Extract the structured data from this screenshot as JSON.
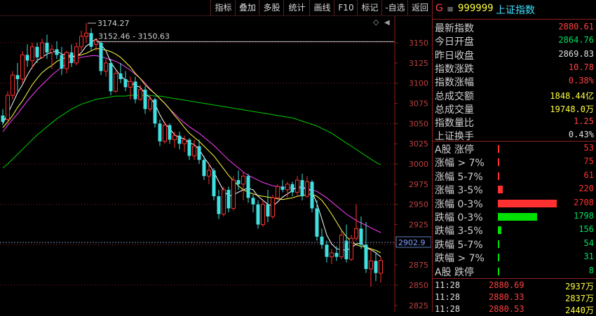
{
  "toolbar": {
    "buttons": [
      "指标",
      "叠加",
      "多股",
      "统计",
      "画线",
      "F10",
      "标记",
      "-自选",
      "返回"
    ]
  },
  "header": {
    "icon_letter": "G",
    "menu_glyph": "≡",
    "code": "999999",
    "name": "上证指数"
  },
  "quote": [
    {
      "label": "最新指数",
      "value": "2880.61",
      "color": "#ff4040"
    },
    {
      "label": "今日开盘",
      "value": "2864.76",
      "color": "#00e060"
    },
    {
      "label": "昨日收盘",
      "value": "2869.83",
      "color": "#e0e0e0"
    },
    {
      "label": "指数涨跌",
      "value": "10.78",
      "color": "#ff4040"
    },
    {
      "label": "指数涨幅",
      "value": "0.38%",
      "color": "#ff4040"
    },
    {
      "label": "总成交额",
      "value": "1848.44亿",
      "color": "#ffff40"
    },
    {
      "label": "总成交量",
      "value": "19748.0万",
      "color": "#ffff40"
    },
    {
      "label": "指数量比",
      "value": "1.25",
      "color": "#ff4040"
    },
    {
      "label": "上证换手",
      "value": "0.43%",
      "color": "#e0e0e0"
    }
  ],
  "breadth": [
    {
      "label": "A股 涨停",
      "value": "53",
      "count": 53,
      "color": "#ff3030",
      "bar": "#ff3030"
    },
    {
      "label": "涨幅 > 7%",
      "value": "75",
      "count": 75,
      "color": "#ff3030",
      "bar": "#ff3030"
    },
    {
      "label": "涨幅 5-7%",
      "value": "61",
      "count": 61,
      "color": "#ff3030",
      "bar": "#ff3030"
    },
    {
      "label": "涨幅 3-5%",
      "value": "220",
      "count": 220,
      "color": "#ff3030",
      "bar": "#ff3030"
    },
    {
      "label": "涨幅 0-3%",
      "value": "2708",
      "count": 2708,
      "color": "#ff3030",
      "bar": "#ff3030"
    },
    {
      "label": "跌幅 0-3%",
      "value": "1798",
      "count": 1798,
      "color": "#00e060",
      "bar": "#00e000"
    },
    {
      "label": "跌幅 3-5%",
      "value": "156",
      "count": 156,
      "color": "#00e060",
      "bar": "#00e000"
    },
    {
      "label": "跌幅 5-7%",
      "value": "54",
      "count": 54,
      "color": "#00e060",
      "bar": "#00e000"
    },
    {
      "label": "跌幅 > 7%",
      "value": "31",
      "count": 31,
      "color": "#00e060",
      "bar": "#00e000"
    },
    {
      "label": "A股 跌停",
      "value": "8",
      "count": 8,
      "color": "#00e060",
      "bar": "#00e000"
    }
  ],
  "ticks": [
    {
      "time": "11:28",
      "price": "2880.69",
      "volume": "2937万"
    },
    {
      "time": "11:28",
      "price": "2880.33",
      "volume": "2837万"
    },
    {
      "time": "11:28",
      "price": "2880.53",
      "volume": "2440万"
    }
  ],
  "chart_data": {
    "type": "candlestick",
    "y_ticks": [
      3150,
      3125,
      3100,
      3075,
      3050,
      3025,
      3000,
      2975,
      2950,
      2925,
      2900,
      2875,
      2850,
      2825
    ],
    "y_range": [
      2817,
      3183
    ],
    "current_price_label": "2902.9",
    "current_price": 2902.9,
    "high_annotation": "3174.27",
    "high_value": 3174.27,
    "high_index": 17,
    "range_annotation": "3152.46 - 3150.63",
    "range_value": 3151.5,
    "range_index": 19,
    "candles": [
      {
        "o": 3060,
        "h": 3068,
        "l": 3048,
        "c": 3052
      },
      {
        "o": 3055,
        "h": 3090,
        "l": 3050,
        "c": 3085
      },
      {
        "o": 3085,
        "h": 3115,
        "l": 3080,
        "c": 3110
      },
      {
        "o": 3110,
        "h": 3125,
        "l": 3090,
        "c": 3105
      },
      {
        "o": 3105,
        "h": 3140,
        "l": 3100,
        "c": 3135
      },
      {
        "o": 3135,
        "h": 3148,
        "l": 3120,
        "c": 3128
      },
      {
        "o": 3128,
        "h": 3150,
        "l": 3118,
        "c": 3145
      },
      {
        "o": 3145,
        "h": 3150,
        "l": 3125,
        "c": 3132
      },
      {
        "o": 3132,
        "h": 3155,
        "l": 3130,
        "c": 3150
      },
      {
        "o": 3150,
        "h": 3160,
        "l": 3130,
        "c": 3138
      },
      {
        "o": 3138,
        "h": 3148,
        "l": 3118,
        "c": 3142
      },
      {
        "o": 3142,
        "h": 3152,
        "l": 3130,
        "c": 3135
      },
      {
        "o": 3135,
        "h": 3145,
        "l": 3110,
        "c": 3118
      },
      {
        "o": 3118,
        "h": 3140,
        "l": 3112,
        "c": 3138
      },
      {
        "o": 3138,
        "h": 3148,
        "l": 3120,
        "c": 3125
      },
      {
        "o": 3125,
        "h": 3150,
        "l": 3122,
        "c": 3145
      },
      {
        "o": 3145,
        "h": 3165,
        "l": 3140,
        "c": 3158
      },
      {
        "o": 3158,
        "h": 3174.27,
        "l": 3150,
        "c": 3162
      },
      {
        "o": 3162,
        "h": 3168,
        "l": 3140,
        "c": 3145
      },
      {
        "o": 3148,
        "h": 3156,
        "l": 3140,
        "c": 3153
      },
      {
        "o": 3150,
        "h": 3152,
        "l": 3110,
        "c": 3115
      },
      {
        "o": 3115,
        "h": 3130,
        "l": 3108,
        "c": 3125
      },
      {
        "o": 3125,
        "h": 3130,
        "l": 3085,
        "c": 3090
      },
      {
        "o": 3090,
        "h": 3115,
        "l": 3088,
        "c": 3112
      },
      {
        "o": 3112,
        "h": 3125,
        "l": 3100,
        "c": 3105
      },
      {
        "o": 3105,
        "h": 3115,
        "l": 3090,
        "c": 3095
      },
      {
        "o": 3095,
        "h": 3108,
        "l": 3080,
        "c": 3102
      },
      {
        "o": 3102,
        "h": 3108,
        "l": 3075,
        "c": 3080
      },
      {
        "o": 3080,
        "h": 3098,
        "l": 3078,
        "c": 3092
      },
      {
        "o": 3092,
        "h": 3096,
        "l": 3062,
        "c": 3068
      },
      {
        "o": 3068,
        "h": 3085,
        "l": 3065,
        "c": 3080
      },
      {
        "o": 3080,
        "h": 3082,
        "l": 3045,
        "c": 3050
      },
      {
        "o": 3050,
        "h": 3055,
        "l": 3022,
        "c": 3028
      },
      {
        "o": 3028,
        "h": 3052,
        "l": 3025,
        "c": 3048
      },
      {
        "o": 3048,
        "h": 3050,
        "l": 3025,
        "c": 3030
      },
      {
        "o": 3030,
        "h": 3040,
        "l": 3020,
        "c": 3035
      },
      {
        "o": 3035,
        "h": 3040,
        "l": 3018,
        "c": 3025
      },
      {
        "o": 3025,
        "h": 3035,
        "l": 3015,
        "c": 3030
      },
      {
        "o": 3030,
        "h": 3032,
        "l": 3005,
        "c": 3010
      },
      {
        "o": 3010,
        "h": 3030,
        "l": 3005,
        "c": 3022
      },
      {
        "o": 3022,
        "h": 3030,
        "l": 3000,
        "c": 3005
      },
      {
        "o": 3005,
        "h": 3010,
        "l": 2980,
        "c": 2985
      },
      {
        "o": 2985,
        "h": 3000,
        "l": 2975,
        "c": 2992
      },
      {
        "o": 2992,
        "h": 2995,
        "l": 2955,
        "c": 2960
      },
      {
        "o": 2960,
        "h": 2968,
        "l": 2932,
        "c": 2938
      },
      {
        "o": 2938,
        "h": 2972,
        "l": 2935,
        "c": 2968
      },
      {
        "o": 2968,
        "h": 2972,
        "l": 2940,
        "c": 2945
      },
      {
        "o": 2945,
        "h": 2985,
        "l": 2942,
        "c": 2980
      },
      {
        "o": 2980,
        "h": 2992,
        "l": 2968,
        "c": 2975
      },
      {
        "o": 2975,
        "h": 2990,
        "l": 2955,
        "c": 2985
      },
      {
        "o": 2985,
        "h": 2988,
        "l": 2952,
        "c": 2958
      },
      {
        "o": 2958,
        "h": 2962,
        "l": 2940,
        "c": 2950
      },
      {
        "o": 2950,
        "h": 2955,
        "l": 2920,
        "c": 2925
      },
      {
        "o": 2925,
        "h": 2955,
        "l": 2922,
        "c": 2950
      },
      {
        "o": 2950,
        "h": 2968,
        "l": 2928,
        "c": 2935
      },
      {
        "o": 2935,
        "h": 2962,
        "l": 2932,
        "c": 2958
      },
      {
        "o": 2958,
        "h": 2975,
        "l": 2955,
        "c": 2972
      },
      {
        "o": 2972,
        "h": 2980,
        "l": 2965,
        "c": 2968
      },
      {
        "o": 2968,
        "h": 2978,
        "l": 2958,
        "c": 2975
      },
      {
        "o": 2975,
        "h": 2978,
        "l": 2960,
        "c": 2965
      },
      {
        "o": 2965,
        "h": 2985,
        "l": 2960,
        "c": 2980
      },
      {
        "o": 2980,
        "h": 2988,
        "l": 2955,
        "c": 2960
      },
      {
        "o": 2960,
        "h": 2985,
        "l": 2958,
        "c": 2978
      },
      {
        "o": 2978,
        "h": 2980,
        "l": 2940,
        "c": 2945
      },
      {
        "o": 2945,
        "h": 2955,
        "l": 2905,
        "c": 2910
      },
      {
        "o": 2910,
        "h": 2920,
        "l": 2895,
        "c": 2900
      },
      {
        "o": 2900,
        "h": 2905,
        "l": 2878,
        "c": 2885
      },
      {
        "o": 2885,
        "h": 2895,
        "l": 2876,
        "c": 2890
      },
      {
        "o": 2890,
        "h": 2898,
        "l": 2880,
        "c": 2885
      },
      {
        "o": 2885,
        "h": 2918,
        "l": 2882,
        "c": 2912
      },
      {
        "o": 2905,
        "h": 2925,
        "l": 2878,
        "c": 2882
      },
      {
        "o": 2882,
        "h": 2912,
        "l": 2880,
        "c": 2908
      },
      {
        "o": 2908,
        "h": 2950,
        "l": 2905,
        "c": 2920
      },
      {
        "o": 2920,
        "h": 2935,
        "l": 2895,
        "c": 2900
      },
      {
        "o": 2900,
        "h": 2928,
        "l": 2865,
        "c": 2870
      },
      {
        "o": 2870,
        "h": 2895,
        "l": 2848,
        "c": 2880
      },
      {
        "o": 2880,
        "h": 2890,
        "l": 2855,
        "c": 2865
      },
      {
        "o": 2864.76,
        "h": 2885,
        "l": 2853,
        "c": 2880.61
      }
    ],
    "ma5": [
      3050,
      3062,
      3075,
      3088,
      3098,
      3110,
      3120,
      3128,
      3132,
      3136,
      3138,
      3140,
      3136,
      3135,
      3133,
      3132,
      3138,
      3146,
      3150,
      3155,
      3148,
      3140,
      3126,
      3117,
      3109,
      3104,
      3101,
      3097,
      3095,
      3087,
      3082,
      3074,
      3061,
      3050,
      3044,
      3036,
      3033,
      3031,
      3026,
      3024,
      3018,
      3008,
      3000,
      2990,
      2978,
      2967,
      2960,
      2962,
      2965,
      2968,
      2970,
      2968,
      2960,
      2955,
      2950,
      2948,
      2953,
      2959,
      2963,
      2967,
      2972,
      2971,
      2970,
      2966,
      2951,
      2932,
      2912,
      2901,
      2895,
      2894,
      2893,
      2896,
      2901,
      2902,
      2896,
      2894,
      2890,
      2885
    ],
    "ma10": [
      3045,
      3052,
      3060,
      3070,
      3078,
      3088,
      3098,
      3106,
      3113,
      3118,
      3122,
      3127,
      3130,
      3132,
      3133,
      3134,
      3135,
      3137,
      3140,
      3143,
      3142,
      3141,
      3139,
      3136,
      3132,
      3126,
      3120,
      3112,
      3106,
      3098,
      3092,
      3087,
      3081,
      3075,
      3068,
      3060,
      3053,
      3045,
      3038,
      3033,
      3028,
      3022,
      3016,
      3010,
      3002,
      2994,
      2986,
      2979,
      2973,
      2968,
      2965,
      2963,
      2961,
      2960,
      2959,
      2958,
      2957,
      2956,
      2957,
      2958,
      2960,
      2961,
      2962,
      2963,
      2960,
      2955,
      2947,
      2938,
      2928,
      2918,
      2910,
      2904,
      2900,
      2898,
      2897,
      2895,
      2893,
      2890
    ],
    "ma20": [
      3040,
      3048,
      3055,
      3062,
      3070,
      3078,
      3085,
      3092,
      3098,
      3104,
      3110,
      3115,
      3120,
      3124,
      3127,
      3130,
      3132,
      3133,
      3134,
      3134,
      3133,
      3131,
      3129,
      3127,
      3124,
      3120,
      3116,
      3111,
      3106,
      3100,
      3093,
      3087,
      3081,
      3075,
      3068,
      3062,
      3056,
      3051,
      3046,
      3042,
      3038,
      3033,
      3028,
      3023,
      3017,
      3011,
      3005,
      3000,
      2995,
      2990,
      2986,
      2983,
      2980,
      2977,
      2975,
      2973,
      2972,
      2971,
      2971,
      2970,
      2970,
      2970,
      2969,
      2968,
      2966,
      2962,
      2958,
      2953,
      2948,
      2943,
      2938,
      2934,
      2930,
      2927,
      2924,
      2921,
      2918,
      2915
    ],
    "ma60": [
      2995,
      3000,
      3006,
      3012,
      3018,
      3024,
      3030,
      3036,
      3041,
      3046,
      3051,
      3056,
      3060,
      3064,
      3068,
      3071,
      3074,
      3076,
      3078,
      3080,
      3081,
      3082,
      3083,
      3084,
      3084,
      3084,
      3085,
      3085,
      3085,
      3085,
      3085,
      3084,
      3084,
      3083,
      3082,
      3081,
      3080,
      3079,
      3078,
      3077,
      3076,
      3075,
      3074,
      3073,
      3072,
      3071,
      3070,
      3069,
      3068,
      3067,
      3066,
      3065,
      3064,
      3063,
      3062,
      3061,
      3060,
      3059,
      3058,
      3057,
      3055,
      3053,
      3051,
      3049,
      3047,
      3044,
      3041,
      3038,
      3034,
      3030,
      3026,
      3022,
      3018,
      3014,
      3010,
      3006,
      3002,
      2999
    ],
    "colors": {
      "up": "#ff3030",
      "down": "#40e0e0",
      "ma5": "#ffffff",
      "ma10": "#ffff40",
      "ma20": "#ff40ff",
      "ma60": "#00d000",
      "grid": "#8b2020",
      "axis_text": "#c04040"
    }
  }
}
